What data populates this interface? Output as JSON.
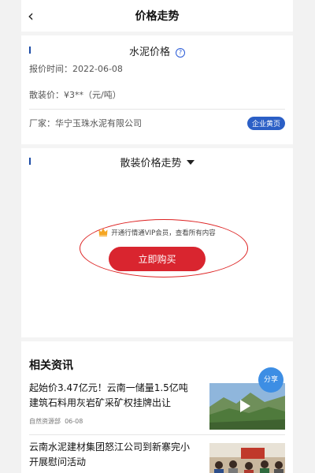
{
  "header": {
    "back_icon": "chevron-left-icon",
    "back_glyph": "‹",
    "title": "价格走势"
  },
  "price_card": {
    "title": "水泥价格",
    "help_glyph": "?",
    "report_time": "报价时间：2022-06-08",
    "bulk_price_label": "散装价：",
    "bulk_price_value": "¥3**",
    "bulk_price_unit": "（元/吨）",
    "manufacturer": "厂家：华宁玉珠水泥有限公司",
    "badge": "企业黄页"
  },
  "trend_card": {
    "title": "散装价格走势",
    "vip_text": "开通行情通VIP会员，查看所有内容",
    "buy_label": "立即购买"
  },
  "news": {
    "heading": "相关资讯",
    "share_label": "分享",
    "items": [
      {
        "title": "起始价3.47亿元！云南一储量1.5亿吨建筑石料用灰岩矿采矿权挂牌出让",
        "source": "自然资源部",
        "date": "06-08"
      },
      {
        "title": "云南水泥建材集团怒江公司到新寨完小开展慰问活动",
        "source": "",
        "date": ""
      }
    ]
  },
  "colors": {
    "accent_blue": "#2b5fc6",
    "buy_red": "#d9252f",
    "annotation_red": "#dd2222",
    "share_blue": "#3d8ee4"
  }
}
